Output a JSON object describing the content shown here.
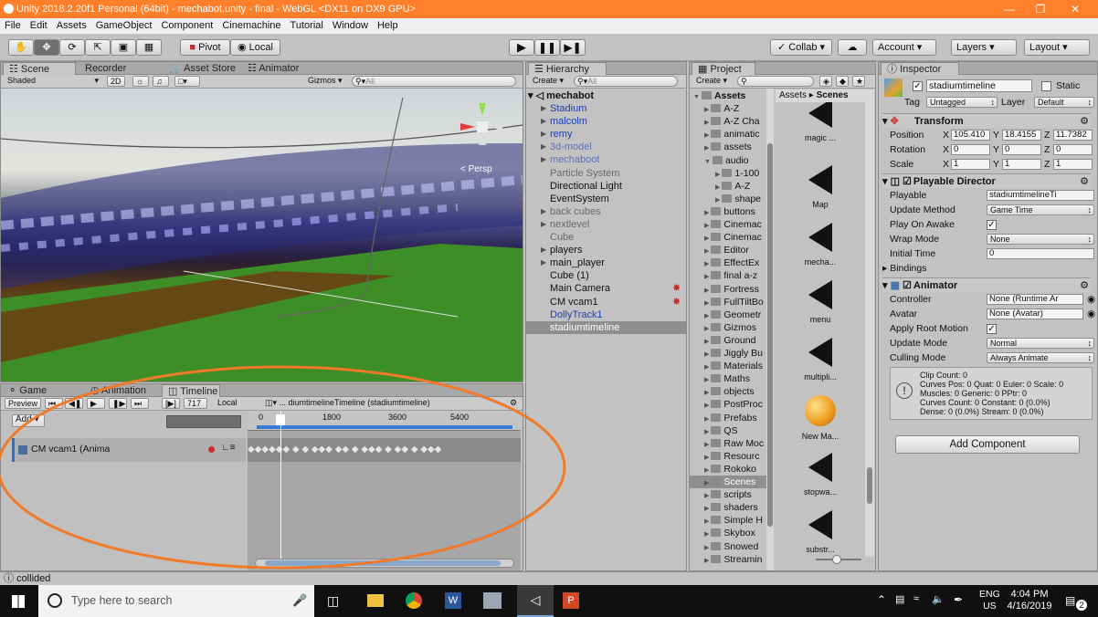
{
  "window": {
    "title": "Unity 2018.2.20f1 Personal (64bit) - mechabot.unity - final - WebGL <DX11 on DX9 GPU>"
  },
  "menu": [
    "File",
    "Edit",
    "Assets",
    "GameObject",
    "Component",
    "Cinemachine",
    "Tutorial",
    "Window",
    "Help"
  ],
  "toolbar": {
    "pivot": "Pivot",
    "local": "Local",
    "collab": "Collab",
    "account": "Account",
    "layers": "Layers",
    "layout": "Layout"
  },
  "scene": {
    "tabs": [
      "Scene",
      "Recorder",
      "Asset Store",
      "Animator"
    ],
    "shading": "Shaded",
    "mode2d": "2D",
    "gizmos": "Gizmos",
    "search_placeholder": "All",
    "persp": "< Persp"
  },
  "timeline": {
    "tabs": [
      "Game",
      "Animation",
      "Timeline"
    ],
    "preview": "Preview",
    "frame": "717",
    "local": "Local",
    "asset": "... diumtimelineTimeline (stadiumtimeline)",
    "add": "Add",
    "ruler": [
      "0",
      "1800",
      "3600",
      "5400"
    ],
    "track": "CM vcam1 (Anima"
  },
  "hierarchy": {
    "tab": "Hierarchy",
    "create": "Create",
    "search_placeholder": "All",
    "scene": "mechabot",
    "items": [
      {
        "label": "Stadium",
        "color": "#1a3fb8",
        "arrow": true
      },
      {
        "label": "malcolm",
        "color": "#1a3fb8",
        "arrow": true
      },
      {
        "label": "remy",
        "color": "#1a3fb8",
        "arrow": true
      },
      {
        "label": "3d-model",
        "color": "#5a6fb0",
        "arrow": true
      },
      {
        "label": "mechaboot",
        "color": "#5a6fb0",
        "arrow": true
      },
      {
        "label": "Particle System",
        "color": "#6a6a6a",
        "arrow": false
      },
      {
        "label": "Directional Light",
        "color": "#111111",
        "arrow": false
      },
      {
        "label": "EventSystem",
        "color": "#111111",
        "arrow": false
      },
      {
        "label": "back cubes",
        "color": "#6a6a6a",
        "arrow": true
      },
      {
        "label": "nextlevel",
        "color": "#6a6a6a",
        "arrow": true
      },
      {
        "label": "Cube",
        "color": "#6a6a6a",
        "arrow": false
      },
      {
        "label": "players",
        "color": "#111111",
        "arrow": true
      },
      {
        "label": "main_player",
        "color": "#111111",
        "arrow": true
      },
      {
        "label": "Cube (1)",
        "color": "#111111",
        "arrow": false
      },
      {
        "label": "Main Camera",
        "color": "#111111",
        "arrow": false
      },
      {
        "label": "CM vcam1",
        "color": "#111111",
        "arrow": false
      },
      {
        "label": "DollyTrack1",
        "color": "#1a3fb8",
        "arrow": false
      },
      {
        "label": "stadiumtimeline",
        "color": "#ffffff",
        "arrow": false
      }
    ]
  },
  "project": {
    "tab": "Project",
    "create": "Create",
    "breadcrumb_root": "Assets",
    "breadcrumb_leaf": "Scenes",
    "tree": [
      {
        "label": "Assets",
        "indent": 0
      },
      {
        "label": "A-Z",
        "indent": 1
      },
      {
        "label": "A-Z Cha",
        "indent": 1
      },
      {
        "label": "animatic",
        "indent": 1
      },
      {
        "label": "assets",
        "indent": 1
      },
      {
        "label": "audio",
        "indent": 1
      },
      {
        "label": "1-100",
        "indent": 2
      },
      {
        "label": "A-Z",
        "indent": 2
      },
      {
        "label": "shape",
        "indent": 2
      },
      {
        "label": "buttons",
        "indent": 1
      },
      {
        "label": "Cinemac",
        "indent": 1
      },
      {
        "label": "Cinemac",
        "indent": 1
      },
      {
        "label": "Editor",
        "indent": 1
      },
      {
        "label": "EffectEx",
        "indent": 1
      },
      {
        "label": "final a-z",
        "indent": 1
      },
      {
        "label": "Fortress",
        "indent": 1
      },
      {
        "label": "FullTiltBo",
        "indent": 1
      },
      {
        "label": "Geometr",
        "indent": 1
      },
      {
        "label": "Gizmos",
        "indent": 1
      },
      {
        "label": "Ground",
        "indent": 1
      },
      {
        "label": "Jiggly Bu",
        "indent": 1
      },
      {
        "label": "Materials",
        "indent": 1
      },
      {
        "label": "Maths",
        "indent": 1
      },
      {
        "label": "objects",
        "indent": 1
      },
      {
        "label": "PostProc",
        "indent": 1
      },
      {
        "label": "Prefabs",
        "indent": 1
      },
      {
        "label": "QS",
        "indent": 1
      },
      {
        "label": "Raw Moc",
        "indent": 1
      },
      {
        "label": "Resourc",
        "indent": 1
      },
      {
        "label": "Rokoko",
        "indent": 1
      },
      {
        "label": "Scenes",
        "indent": 1
      },
      {
        "label": "scripts",
        "indent": 1
      },
      {
        "label": "shaders",
        "indent": 1
      },
      {
        "label": "Simple H",
        "indent": 1
      },
      {
        "label": "Skybox",
        "indent": 1
      },
      {
        "label": "Snowed",
        "indent": 1
      },
      {
        "label": "Streamin",
        "indent": 1
      }
    ],
    "grid": [
      "magic ...",
      "Map",
      "mecha...",
      "menu",
      "multipli...",
      "New Ma...",
      "stopwa...",
      "substr..."
    ]
  },
  "inspector": {
    "tab": "Inspector",
    "object": "stadiumtimeline",
    "static": "Static",
    "tag_label": "Tag",
    "tag": "Untagged",
    "layer_label": "Layer",
    "layer": "Default",
    "transform": {
      "title": "Transform",
      "position": "Position",
      "rotation": "Rotation",
      "scale": "Scale",
      "pos": [
        "105.410",
        "18.4155",
        "11.7382"
      ],
      "rot": [
        "0",
        "0",
        "0"
      ],
      "scl": [
        "1",
        "1",
        "1"
      ]
    },
    "director": {
      "title": "Playable Director",
      "playable_label": "Playable",
      "playable": "stadiumtimelineTi",
      "update_label": "Update Method",
      "update": "Game Time",
      "awake_label": "Play On Awake",
      "wrap_label": "Wrap Mode",
      "wrap": "None",
      "time_label": "Initial Time",
      "time": "0",
      "bindings": "Bindings"
    },
    "animator": {
      "title": "Animator",
      "controller_label": "Controller",
      "controller": "None (Runtime Ar",
      "avatar_label": "Avatar",
      "avatar": "None (Avatar)",
      "root_label": "Apply Root Motion",
      "upd_label": "Update Mode",
      "upd": "Normal",
      "cull_label": "Culling Mode",
      "cull": "Always Animate",
      "info": [
        "Clip Count: 0",
        "Curves Pos: 0 Quat: 0 Euler: 0 Scale: 0",
        "Muscles: 0 Generic: 0 PPtr: 0",
        "Curves Count: 0 Constant: 0 (0.0%)",
        "Dense: 0 (0.0%) Stream: 0 (0.0%)"
      ]
    },
    "add_component": "Add Component"
  },
  "status": {
    "message": "collided"
  },
  "taskbar": {
    "search": "Type here to search",
    "lang": "ENG",
    "region": "US",
    "time": "4:04 PM",
    "date": "4/16/2019",
    "notif": "2"
  }
}
